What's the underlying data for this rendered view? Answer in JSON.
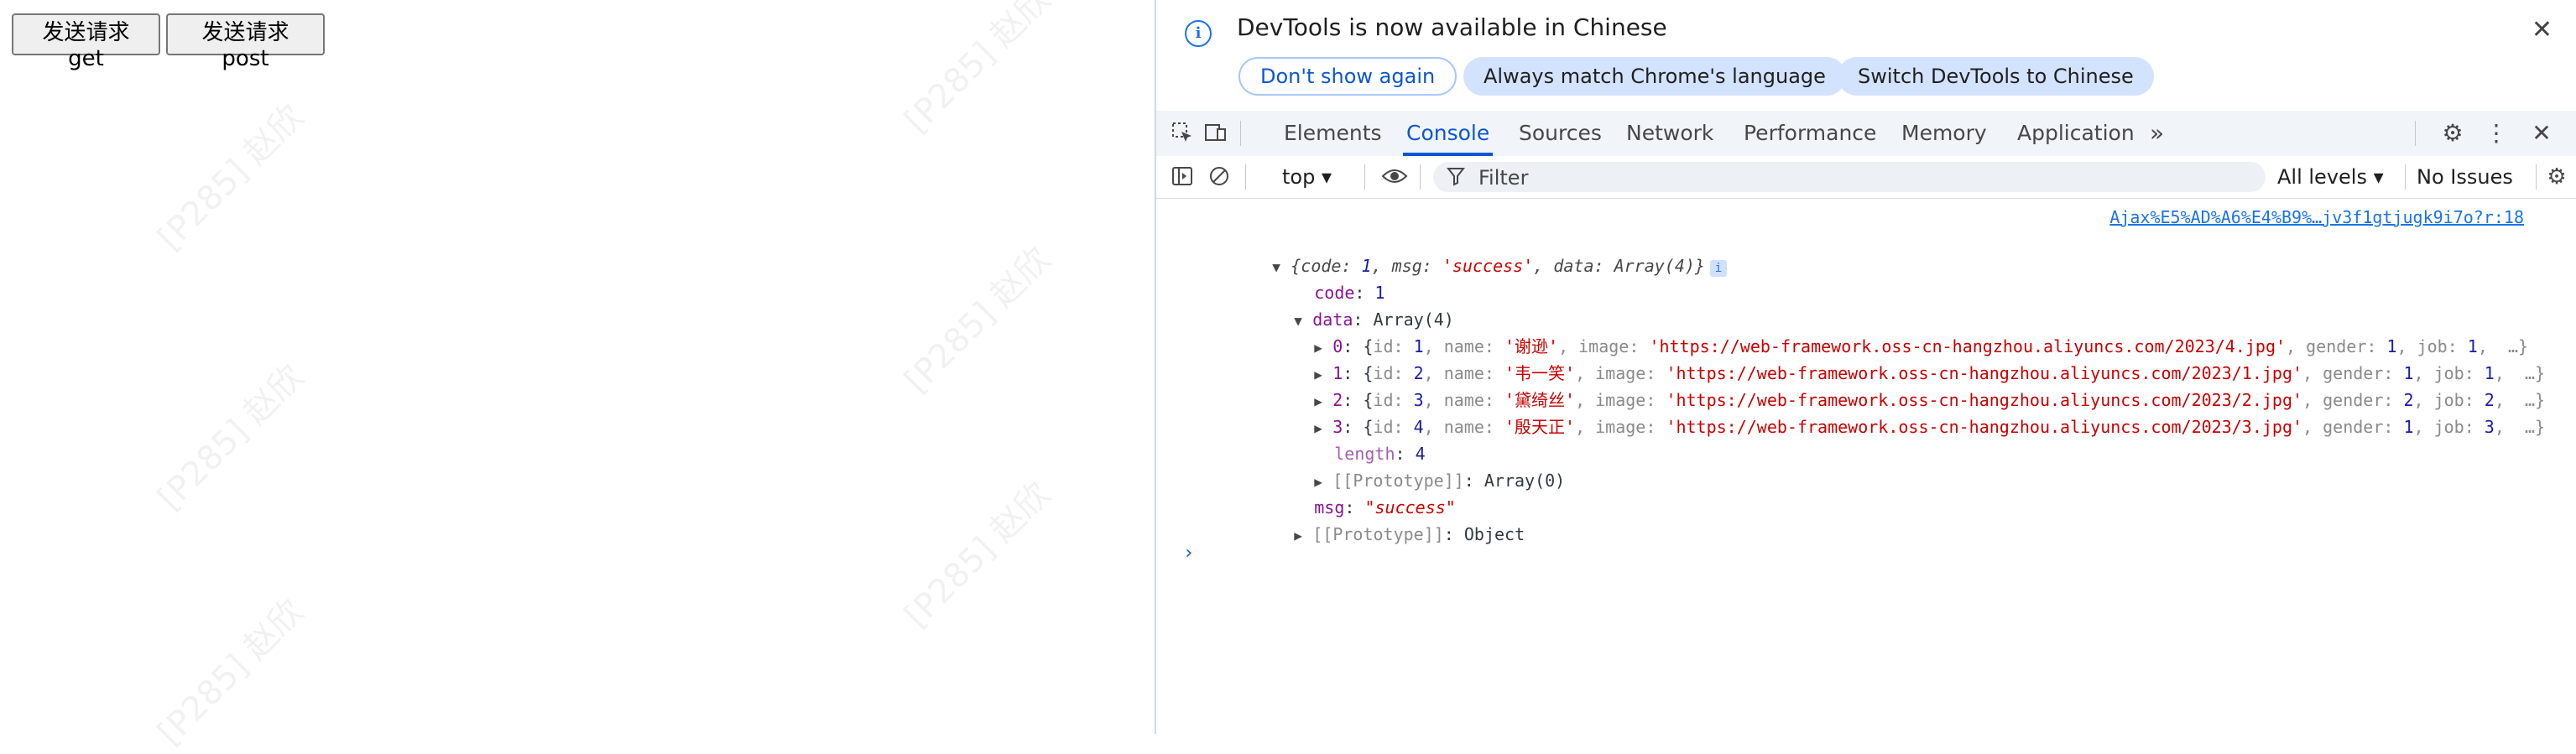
{
  "page": {
    "buttons": {
      "get": "发送请求get",
      "post": "发送请求post"
    },
    "watermark": "[P285] 赵欣"
  },
  "banner": {
    "title": "DevTools is now available in Chinese",
    "dont_show": "Don't show again",
    "always_match": "Always match Chrome's language",
    "switch": "Switch DevTools to Chinese"
  },
  "tabs": {
    "elements": "Elements",
    "console": "Console",
    "sources": "Sources",
    "network": "Network",
    "performance": "Performance",
    "memory": "Memory",
    "application": "Application",
    "more": "»"
  },
  "toolbar": {
    "context": "top ▾",
    "filter_placeholder": "Filter",
    "levels": "All levels ▾",
    "issues": "No Issues"
  },
  "console": {
    "source": "Ajax%E5%AD%A6%E4%B9%…jv3f1gtjugk9i7o?r:18",
    "summary": {
      "open": "{code: ",
      "code": "1",
      "msg_key": ", msg: ",
      "msg": "'success'",
      "data_key": ", data: ",
      "data": "Array(4)}"
    },
    "code_key": "code",
    "code_val": "1",
    "data_key": "data",
    "data_type": "Array(4)",
    "rows": [
      {
        "idx": "0",
        "id": "1",
        "name": "'谢逊'",
        "image": "'https://web-framework.oss-cn-hangzhou.aliyuncs.com/2023/4.jpg'",
        "gender": "1",
        "job": "1"
      },
      {
        "idx": "1",
        "id": "2",
        "name": "'韦一笑'",
        "image": "'https://web-framework.oss-cn-hangzhou.aliyuncs.com/2023/1.jpg'",
        "gender": "1",
        "job": "1"
      },
      {
        "idx": "2",
        "id": "3",
        "name": "'黛绮丝'",
        "image": "'https://web-framework.oss-cn-hangzhou.aliyuncs.com/2023/2.jpg'",
        "gender": "2",
        "job": "2"
      },
      {
        "idx": "3",
        "id": "4",
        "name": "'殷天正'",
        "image": "'https://web-framework.oss-cn-hangzhou.aliyuncs.com/2023/3.jpg'",
        "gender": "1",
        "job": "3"
      }
    ],
    "length_key": "length",
    "length_val": "4",
    "proto_array_key": "[[Prototype]]",
    "proto_array_val": "Array(0)",
    "msg_key": "msg",
    "msg_val": "\"success\"",
    "proto_obj_key": "[[Prototype]]",
    "proto_obj_val": "Object"
  },
  "colors": {
    "accent": "#0b57d0",
    "string": "#c80000",
    "number": "#1a1aa6",
    "key": "#881391"
  }
}
